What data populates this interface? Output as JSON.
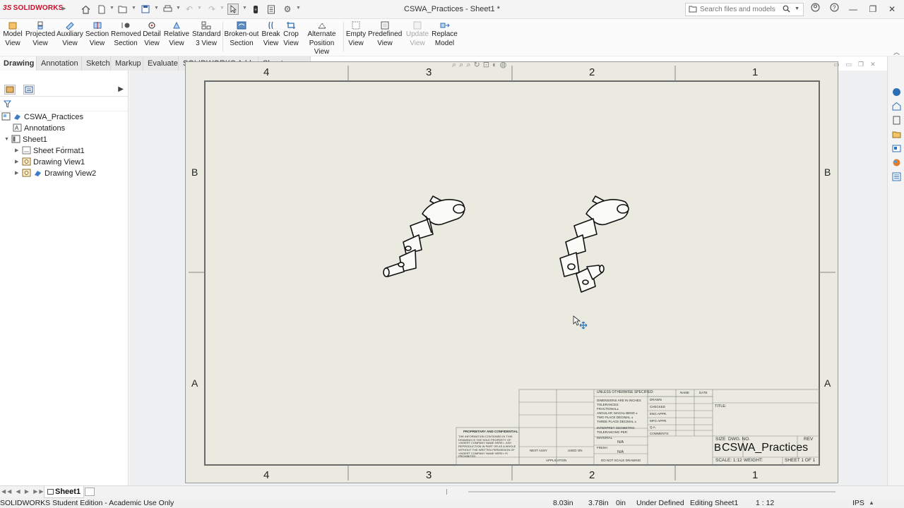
{
  "app": {
    "brand": "SOLIDWORKS",
    "document_title": "CSWA_Practices - Sheet1 *"
  },
  "search": {
    "placeholder": "Search files and models"
  },
  "window_controls": [
    "minimize",
    "restore",
    "close"
  ],
  "ribbon": {
    "buttons": [
      {
        "line1": "Model",
        "line2": "View",
        "enabled": true
      },
      {
        "line1": "Projected",
        "line2": "View",
        "enabled": true
      },
      {
        "line1": "Auxiliary",
        "line2": "View",
        "enabled": true
      },
      {
        "line1": "Section",
        "line2": "View",
        "enabled": true
      },
      {
        "line1": "Removed",
        "line2": "Section",
        "enabled": true
      },
      {
        "line1": "Detail",
        "line2": "View",
        "enabled": true
      },
      {
        "line1": "Relative",
        "line2": "View",
        "enabled": true
      },
      {
        "line1": "Standard",
        "line2": "3 View",
        "enabled": true
      },
      {
        "line1": "Broken-out",
        "line2": "Section",
        "enabled": true
      },
      {
        "line1": "Break",
        "line2": "View",
        "enabled": true
      },
      {
        "line1": "Crop",
        "line2": "View",
        "enabled": true
      },
      {
        "line1": "Alternate",
        "line2": "Position View",
        "enabled": true
      },
      {
        "line1": "Empty",
        "line2": "View",
        "enabled": true
      },
      {
        "line1": "Predefined",
        "line2": "View",
        "enabled": true
      },
      {
        "line1": "Update",
        "line2": "View",
        "enabled": false
      },
      {
        "line1": "Replace",
        "line2": "Model",
        "enabled": true
      }
    ]
  },
  "command_tabs": [
    {
      "label": "Drawing",
      "active": true
    },
    {
      "label": "Annotation",
      "active": false
    },
    {
      "label": "Sketch",
      "active": false
    },
    {
      "label": "Markup",
      "active": false
    },
    {
      "label": "Evaluate",
      "active": false
    },
    {
      "label": "SOLIDWORKS Add-Ins",
      "active": false
    },
    {
      "label": "Sheet Format",
      "active": false
    }
  ],
  "feature_tree": {
    "root": "CSWA_Practices",
    "annotations": "Annotations",
    "sheet": "Sheet1",
    "sheet_format": "Sheet Format1",
    "view1": "Drawing View1",
    "view2": "Drawing View2"
  },
  "sheet": {
    "top_zones": [
      "4",
      "3",
      "2",
      "1"
    ],
    "bottom_zones": [
      "4",
      "3",
      "2",
      "1"
    ],
    "left_zones": [
      "B",
      "A"
    ],
    "right_zones": [
      "B",
      "A"
    ]
  },
  "title_block": {
    "unless_otherwise": "UNLESS OTHERWISE SPECIFIED:",
    "name": "NAME",
    "date": "DATE",
    "dimensions": "DIMENSIONS ARE IN INCHES",
    "tolerances": "TOLERANCES:",
    "fractional": "FRACTIONAL±",
    "angular": "ANGULAR: MACH±  BEND ±",
    "two_place": "TWO PLACE DECIMAL   ±",
    "three_place": "THREE PLACE DECIMAL  ±",
    "interpret": "INTERPRET GEOMETRIC",
    "tolerancing": "TOLERANCING PER:",
    "material": "MATERIAL",
    "finish": "FINISH",
    "na1": "N/A",
    "na2": "N/A",
    "drawn": "DRAWN",
    "checked": "CHECKED",
    "eng_appr": "ENG APPR.",
    "mfg_appr": "MFG APPR.",
    "qa": "Q.A.",
    "comments": "COMMENTS:",
    "title_label": "TITLE:",
    "next_assy": "NEXT ASSY",
    "used_on": "USED ON",
    "application": "APPLICATION",
    "no_scale": "DO NOT SCALE DRAWING",
    "proprietary": "PROPRIETARY AND CONFIDENTIAL",
    "prop_text": [
      "THE INFORMATION CONTAINED IN THIS",
      "DRAWING IS THE SOLE PROPERTY OF",
      "<INSERT COMPANY NAME HERE>. ANY",
      "REPRODUCTION IN PART OR AS A WHOLE",
      "WITHOUT THE WRITTEN PERMISSION OF",
      "<INSERT COMPANY NAME HERE> IS",
      "PROHIBITED."
    ],
    "size": "SIZE",
    "dwg_no": "DWG.  NO.",
    "rev": "REV",
    "size_value": "B",
    "dwg_value": "CSWA_Practices",
    "scale": "SCALE: 1:12",
    "weight": "WEIGHT:",
    "sheet_of": "SHEET 1 OF 1"
  },
  "sheet_tab": "Sheet1",
  "status_bar": {
    "edition": "SOLIDWORKS Student Edition - Academic Use Only",
    "x": "8.03in",
    "y": "3.78in",
    "z": "0in",
    "defined": "Under Defined",
    "editing": "Editing Sheet1",
    "scale": "1 : 12",
    "units": "IPS"
  },
  "colors": {
    "sheet_fill": "#eaeae1",
    "graphics_bg": "#eef0f2",
    "brand_red": "#c8102e",
    "ribbon_icon_blue": "#2e6fb5"
  }
}
